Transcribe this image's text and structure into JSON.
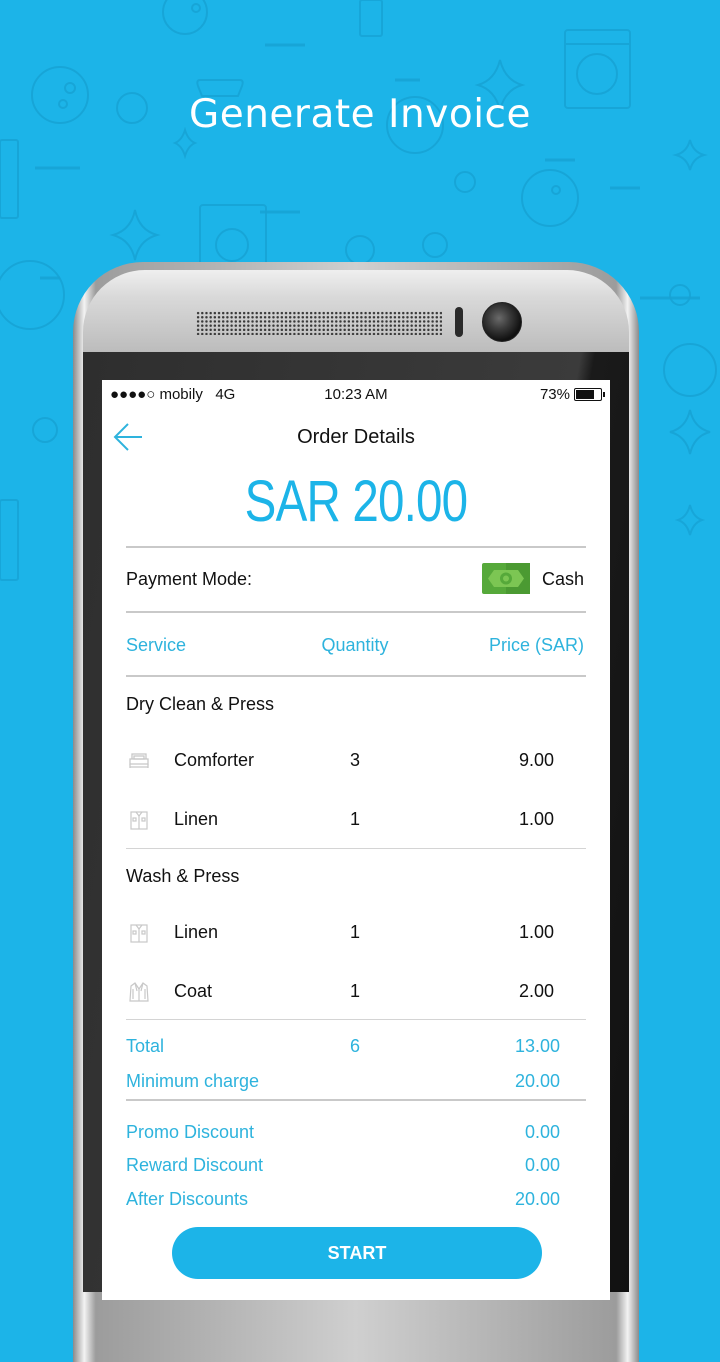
{
  "promo": {
    "title": "Generate Invoice"
  },
  "status_bar": {
    "carrier": "●●●●○ mobily",
    "network": "4G",
    "time": "10:23 AM",
    "battery": "73%",
    "battery_level": 0.73
  },
  "nav": {
    "title": "Order Details",
    "back_icon": "arrow-left-icon"
  },
  "amount": "SAR 20.00",
  "payment": {
    "label": "Payment Mode:",
    "method": "Cash",
    "icon": "cash-icon"
  },
  "table": {
    "headers": {
      "service": "Service",
      "quantity": "Quantity",
      "price": "Price (SAR)"
    },
    "groups": [
      {
        "name": "Dry Clean & Press",
        "items": [
          {
            "icon": "bed-icon",
            "name": "Comforter",
            "quantity": "3",
            "price": "9.00"
          },
          {
            "icon": "shirt-icon",
            "name": "Linen",
            "quantity": "1",
            "price": "1.00"
          }
        ]
      },
      {
        "name": "Wash & Press",
        "items": [
          {
            "icon": "shirt-icon",
            "name": "Linen",
            "quantity": "1",
            "price": "1.00"
          },
          {
            "icon": "coat-icon",
            "name": "Coat",
            "quantity": "1",
            "price": "2.00"
          }
        ]
      }
    ]
  },
  "totals": {
    "total": {
      "label": "Total",
      "quantity": "6",
      "price": "13.00"
    },
    "minimum_charge": {
      "label": "Minimum charge",
      "price": "20.00"
    }
  },
  "discounts": {
    "promo": {
      "label": "Promo Discount",
      "value": "0.00"
    },
    "reward": {
      "label": "Reward Discount",
      "value": "0.00"
    },
    "after": {
      "label": "After Discounts",
      "value": "20.00"
    }
  },
  "actions": {
    "start_label": "START"
  },
  "colors": {
    "accent": "#1cb4e8",
    "background": "#1cb4e8",
    "text": "#111111",
    "link_text": "#2eb3dd"
  }
}
